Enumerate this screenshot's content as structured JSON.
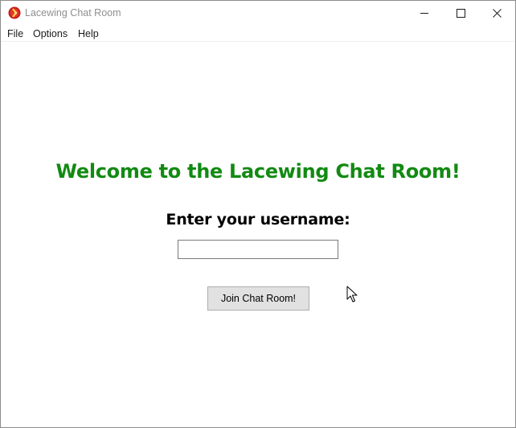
{
  "window": {
    "title": "Lacewing Chat Room",
    "app_icon": "lacewing-app-icon",
    "controls": {
      "minimize_icon": "minimize-icon",
      "maximize_icon": "maximize-icon",
      "close_icon": "close-icon"
    }
  },
  "menubar": {
    "items": [
      {
        "label": "File"
      },
      {
        "label": "Options"
      },
      {
        "label": "Help"
      }
    ]
  },
  "main": {
    "welcome": "Welcome to the Lacewing Chat Room!",
    "prompt": "Enter your username:",
    "username_value": "",
    "join_label": "Join Chat Room!"
  },
  "colors": {
    "welcome_text": "#128a12",
    "button_bg": "#e1e1e1",
    "button_border": "#adadad",
    "title_text": "#8f8f8f"
  }
}
